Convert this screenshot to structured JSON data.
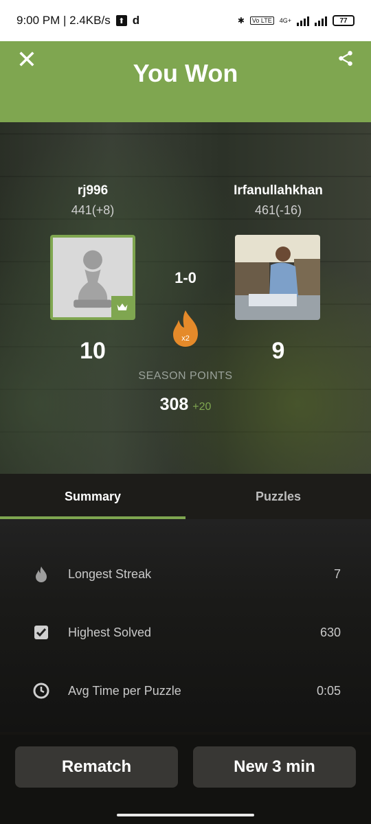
{
  "status": {
    "time_speed": "9:00 PM | 2.4KB/s",
    "network": "4G+",
    "battery": "77"
  },
  "header": {
    "title": "You Won"
  },
  "players": {
    "left": {
      "name": "rj996",
      "rating": "441(+8)",
      "points": "10"
    },
    "right": {
      "name": "Irfanullahkhan",
      "rating": "461(-16)",
      "points": "9"
    }
  },
  "match": {
    "score": "1-0",
    "multiplier": "x2"
  },
  "season": {
    "label": "SEASON POINTS",
    "value": "308",
    "gain": "+20"
  },
  "tabs": [
    {
      "label": "Summary",
      "active": true
    },
    {
      "label": "Puzzles",
      "active": false
    }
  ],
  "stats": [
    {
      "icon": "flame-icon",
      "label": "Longest Streak",
      "value": "7"
    },
    {
      "icon": "checkbox-icon",
      "label": "Highest Solved",
      "value": "630"
    },
    {
      "icon": "clock-icon",
      "label": "Avg Time per Puzzle",
      "value": "0:05"
    }
  ],
  "buttons": {
    "rematch": "Rematch",
    "new_game": "New 3 min"
  },
  "colors": {
    "accent": "#7fa650",
    "background": "#161512"
  }
}
